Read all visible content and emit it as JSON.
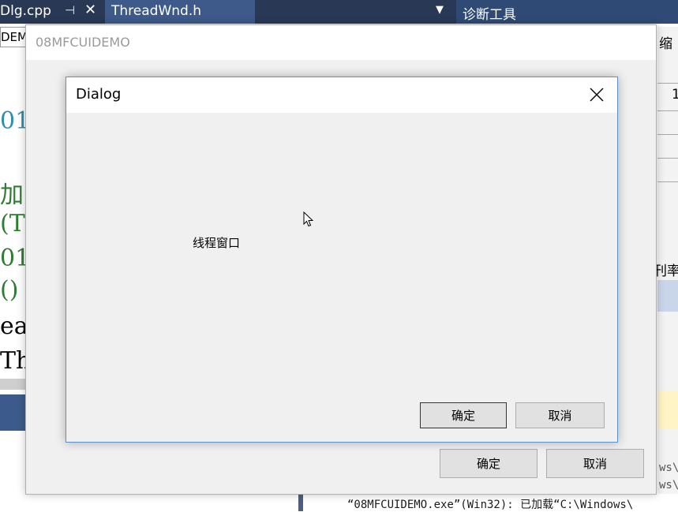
{
  "vs": {
    "tab_left": "Dlg.cpp",
    "tab_active": "ThreadWnd.h",
    "diag_tools": "诊断工具",
    "combo_text": "DEMO",
    "code_frag": [
      "01",
      "加",
      "(TI",
      "01",
      "()",
      "ea",
      "Thi"
    ],
    "right_panel": {
      "t1": "、缩",
      "t2": "1",
      "t3": "刊率"
    },
    "output_line": "“08MFCUIDEMO.exe”(Win32): 已加载“C:\\Windows\\",
    "output_tails": [
      "ws\\",
      "ws\\"
    ]
  },
  "app": {
    "title": "08MFCUIDEMO",
    "ok_label": "确定",
    "cancel_label": "取消"
  },
  "dialog": {
    "title": "Dialog",
    "static_text": "线程窗口",
    "ok_label": "确定",
    "cancel_label": "取消"
  }
}
